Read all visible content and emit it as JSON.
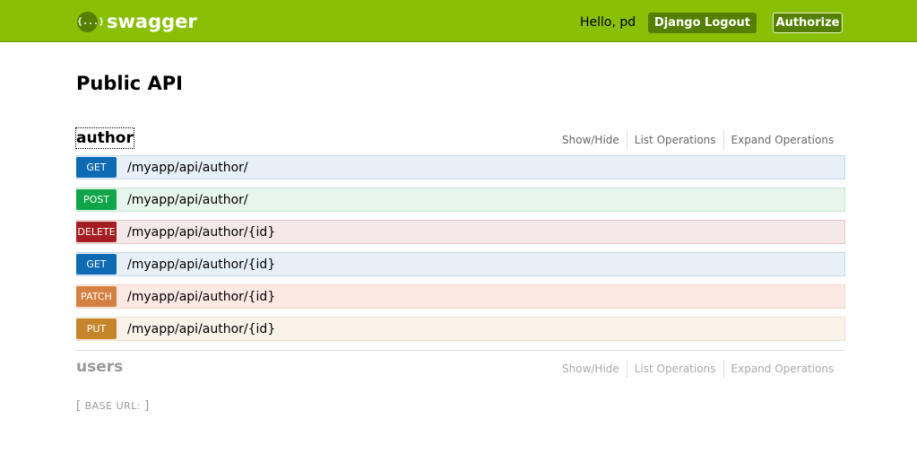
{
  "header": {
    "logo_glyph": "{...}",
    "logo_text": "swagger",
    "greeting": "Hello, pd",
    "logout_label": "Django Logout",
    "authorize_label": "Authorize",
    "brand_color": "#89bf04"
  },
  "page": {
    "title": "Public API"
  },
  "resources": [
    {
      "name": "author",
      "links": [
        "Show/Hide",
        "List Operations",
        "Expand Operations"
      ],
      "operations": [
        {
          "method": "GET",
          "path": "/myapp/api/author/",
          "color": "#0f6ab4"
        },
        {
          "method": "POST",
          "path": "/myapp/api/author/",
          "color": "#10a54a"
        },
        {
          "method": "DELETE",
          "path": "/myapp/api/author/{id}",
          "color": "#a41e22"
        },
        {
          "method": "GET",
          "path": "/myapp/api/author/{id}",
          "color": "#0f6ab4"
        },
        {
          "method": "PATCH",
          "path": "/myapp/api/author/{id}",
          "color": "#d38042"
        },
        {
          "method": "PUT",
          "path": "/myapp/api/author/{id}",
          "color": "#c5862b"
        }
      ]
    },
    {
      "name": "users",
      "links": [
        "Show/Hide",
        "List Operations",
        "Expand Operations"
      ]
    }
  ],
  "footer": {
    "open_bracket": "[",
    "base_url_label": "BASE URL:",
    "close_bracket": "]"
  }
}
